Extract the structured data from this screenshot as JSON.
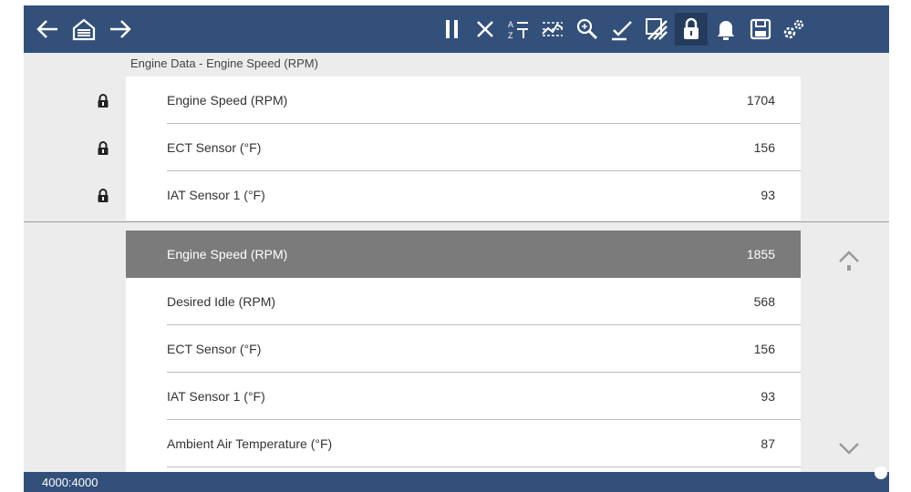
{
  "toolbar": {
    "buttons": [
      {
        "icon": "back-arrow-icon",
        "label": "Back"
      },
      {
        "icon": "home-icon",
        "label": "Home"
      },
      {
        "icon": "forward-arrow-icon",
        "label": "Forward"
      },
      {
        "icon": "pause-icon",
        "label": "Pause"
      },
      {
        "icon": "close-icon",
        "label": "Exit"
      },
      {
        "icon": "sort-icon",
        "label": "Sort"
      },
      {
        "icon": "graph-view-icon",
        "label": "View"
      },
      {
        "icon": "zoom-icon",
        "label": "Zoom"
      },
      {
        "icon": "select-icon",
        "label": "Select"
      },
      {
        "icon": "pid-trigger-icon",
        "label": "Trigger"
      },
      {
        "icon": "lock-icon",
        "label": "Lock"
      },
      {
        "icon": "bell-icon",
        "label": "Alert"
      },
      {
        "icon": "save-icon",
        "label": "Save"
      },
      {
        "icon": "settings-gears-icon",
        "label": "Settings"
      }
    ]
  },
  "graph_title": "Engine Data - Engine Speed (RPM)",
  "locked_items": [
    {
      "name": "Engine Speed (RPM)",
      "value": "1704"
    },
    {
      "name": "ECT Sensor (°F)",
      "value": "156"
    },
    {
      "name": "IAT Sensor 1 (°F)",
      "value": "93"
    }
  ],
  "items": [
    {
      "name": "Engine Speed (RPM)",
      "value": "1855"
    },
    {
      "name": "Desired Idle (RPM)",
      "value": "568"
    },
    {
      "name": "ECT Sensor (°F)",
      "value": "156"
    },
    {
      "name": "IAT Sensor 1 (°F)",
      "value": "93"
    },
    {
      "name": "Ambient Air Temperature (°F)",
      "value": "87"
    }
  ],
  "status": {
    "text": "4000:4000"
  },
  "colors": {
    "toolbar": "#33507a",
    "selected_row": "#7b7b7b",
    "background": "#ececec"
  }
}
